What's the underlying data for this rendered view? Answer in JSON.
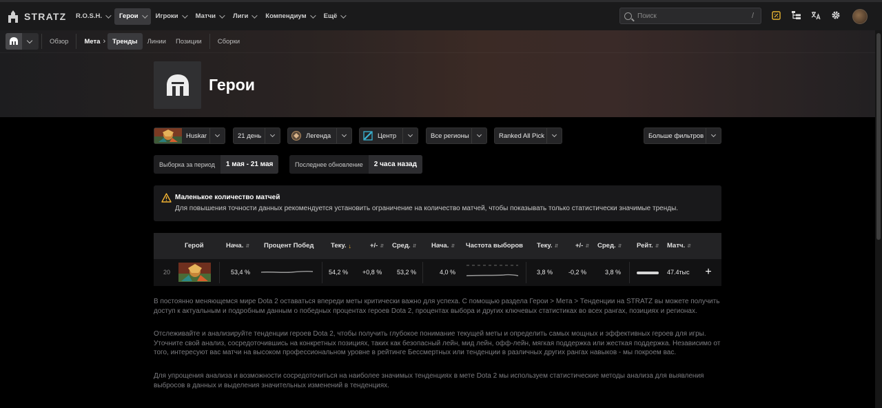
{
  "app": {
    "logo_text": "STRATZ"
  },
  "nav": {
    "items": [
      {
        "label": "R.O.S.H.",
        "active": false
      },
      {
        "label": "Герои",
        "active": true
      },
      {
        "label": "Игроки",
        "active": false
      },
      {
        "label": "Матчи",
        "active": false
      },
      {
        "label": "Лиги",
        "active": false
      },
      {
        "label": "Компендиум",
        "active": false
      },
      {
        "label": "Ещё",
        "active": false
      }
    ]
  },
  "search": {
    "placeholder": "Поиск",
    "shortcut": "/"
  },
  "top_icons": [
    "dota-plus-icon",
    "hierarchy-icon",
    "translate-icon",
    "gear-icon"
  ],
  "subnav": {
    "overview": "Обзор",
    "meta": "Мета",
    "trends": "Тренды",
    "lanes": "Линии",
    "positions": "Позиции",
    "builds": "Сборки"
  },
  "page": {
    "title": "Герои"
  },
  "filters": {
    "hero": "Huskar",
    "days": "21 день",
    "rank": "Легенда",
    "position": "Центр",
    "region": "Все регионы",
    "mode": "Ranked All Pick",
    "more": "Больше фильтров"
  },
  "period": {
    "label": "Выборка за период",
    "value": "1 мая - 21 мая",
    "updated_label": "Последнее обновление",
    "updated_value": "2 часа назад"
  },
  "warning": {
    "title": "Маленькое количество матчей",
    "text": "Для повышения точности данных рекомендуется установить ограничение на количество матчей, чтобы показывать только статистически значимые тренды."
  },
  "table": {
    "headers": {
      "hero": "Герой",
      "start_win": "Нача.",
      "win_group": "Процент Побед",
      "current_win": "Теку.",
      "delta_win": "+/-",
      "avg_win": "Сред.",
      "start_pick": "Нача.",
      "pick_group": "Частота выборов",
      "current_pick": "Теку.",
      "delta_pick": "+/-",
      "avg_pick": "Сред.",
      "rating": "Рейт.",
      "matches": "Матч."
    },
    "rows": [
      {
        "rank": "20",
        "start_win": "53,4 %",
        "current_win": "54,2 %",
        "delta_win": "+0,8 %",
        "avg_win": "53,2 %",
        "start_pick": "4,0 %",
        "current_pick": "3,8 %",
        "delta_pick": "-0,2 %",
        "avg_pick": "3,8 %",
        "rating_fraction": 1.0,
        "matches": "47.4тыс"
      }
    ],
    "add_icon": "plus-icon"
  },
  "description": {
    "p1": "В постоянно меняющемся мире Dota 2 оставаться впереди меты критически важно для успеха. С помощью раздела Герои > Мета > Тенденции на STRATZ вы можете получить доступ к актуальным и подробным данным о победных процентах героев Dota 2, процентах выбора и других ключевых статистиках во всех рангах, позициях и регионах.",
    "p2": "Отслеживайте и анализируйте тенденции героев Dota 2, чтобы получить глубокое понимание текущей меты и определить самых мощных и эффективных героев для игры. Уточните свой анализ, сосредоточившись на конкретных позициях, таких как безопасный лейн, мид лейн, офф-лейн, мягкая поддержка или жесткая поддержка. Независимо от того, интересуют вас матчи на высоком профессиональном уровне в рейтинге Бессмертных или тенденции в различных других рангах навыков - мы покроем вас.",
    "p3": "Для упрощения анализа и возможности сосредоточиться на наиболее значимых тенденциях в мете Dota 2 мы используем статистические методы анализа для выявления выбросов в данных и выделения значительных изменений в тенденциях."
  },
  "colors": {
    "accent_sort": "#f2b332",
    "dota_plus": "#e8b431",
    "background": "#000000",
    "topbar": "#1a1a1b"
  }
}
